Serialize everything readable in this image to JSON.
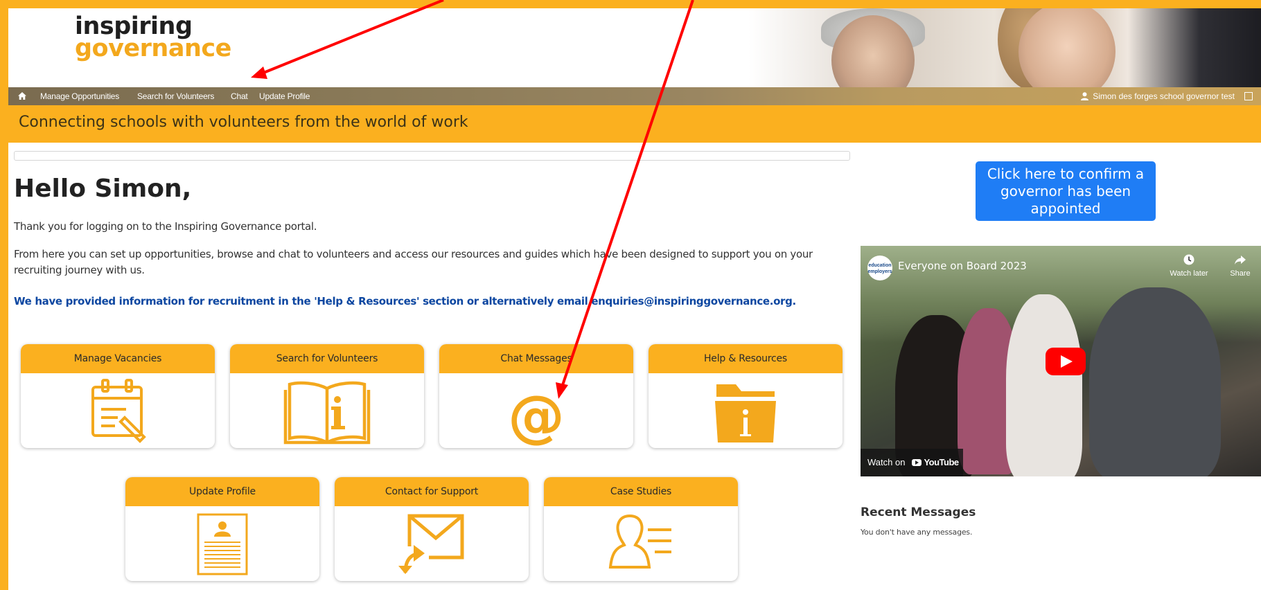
{
  "logo": {
    "line1": "inspiring",
    "line2": "governance"
  },
  "nav": {
    "items": [
      {
        "label": "Manage Opportunities"
      },
      {
        "label": "Search for Volunteers"
      },
      {
        "label": "Chat"
      },
      {
        "label": "Update Profile"
      }
    ],
    "user": "Simon des forges school governor test"
  },
  "tagline": "Connecting schools with volunteers from the world of work",
  "main": {
    "greeting": "Hello Simon,",
    "intro": "Thank you for logging on to the Inspiring Governance portal.",
    "body": "From here you can set up opportunities, browse and chat to volunteers and access our resources and guides which have been designed to support you on your recruiting journey with us.",
    "notice": "We have provided information for recruitment in the 'Help & Resources' section or alternatively email enquiries@inspiringgovernance.org."
  },
  "tiles": [
    {
      "label": "Manage Vacancies",
      "icon": "calendar-edit-icon"
    },
    {
      "label": "Search for Volunteers",
      "icon": "book-info-icon"
    },
    {
      "label": "Chat Messages",
      "icon": "at-sign-icon"
    },
    {
      "label": "Help & Resources",
      "icon": "folder-info-icon"
    },
    {
      "label": "Update Profile",
      "icon": "profile-document-icon"
    },
    {
      "label": "Contact for Support",
      "icon": "envelope-reply-icon"
    },
    {
      "label": "Case Studies",
      "icon": "person-list-icon"
    }
  ],
  "sidebar": {
    "confirm_button": "Click here to confirm a governor has been appointed",
    "video": {
      "title": "Everyone on Board 2023",
      "channel_badge": "education employers",
      "watch_later": "Watch later",
      "share": "Share",
      "watch_on": "Watch on",
      "platform": "YouTube"
    },
    "recent_title": "Recent Messages",
    "recent_empty": "You don't have any messages."
  },
  "colors": {
    "accent": "#fbb01f",
    "link_blue": "#0d47a1",
    "button_blue": "#1f7df5",
    "annotation_red": "#ff0000"
  }
}
